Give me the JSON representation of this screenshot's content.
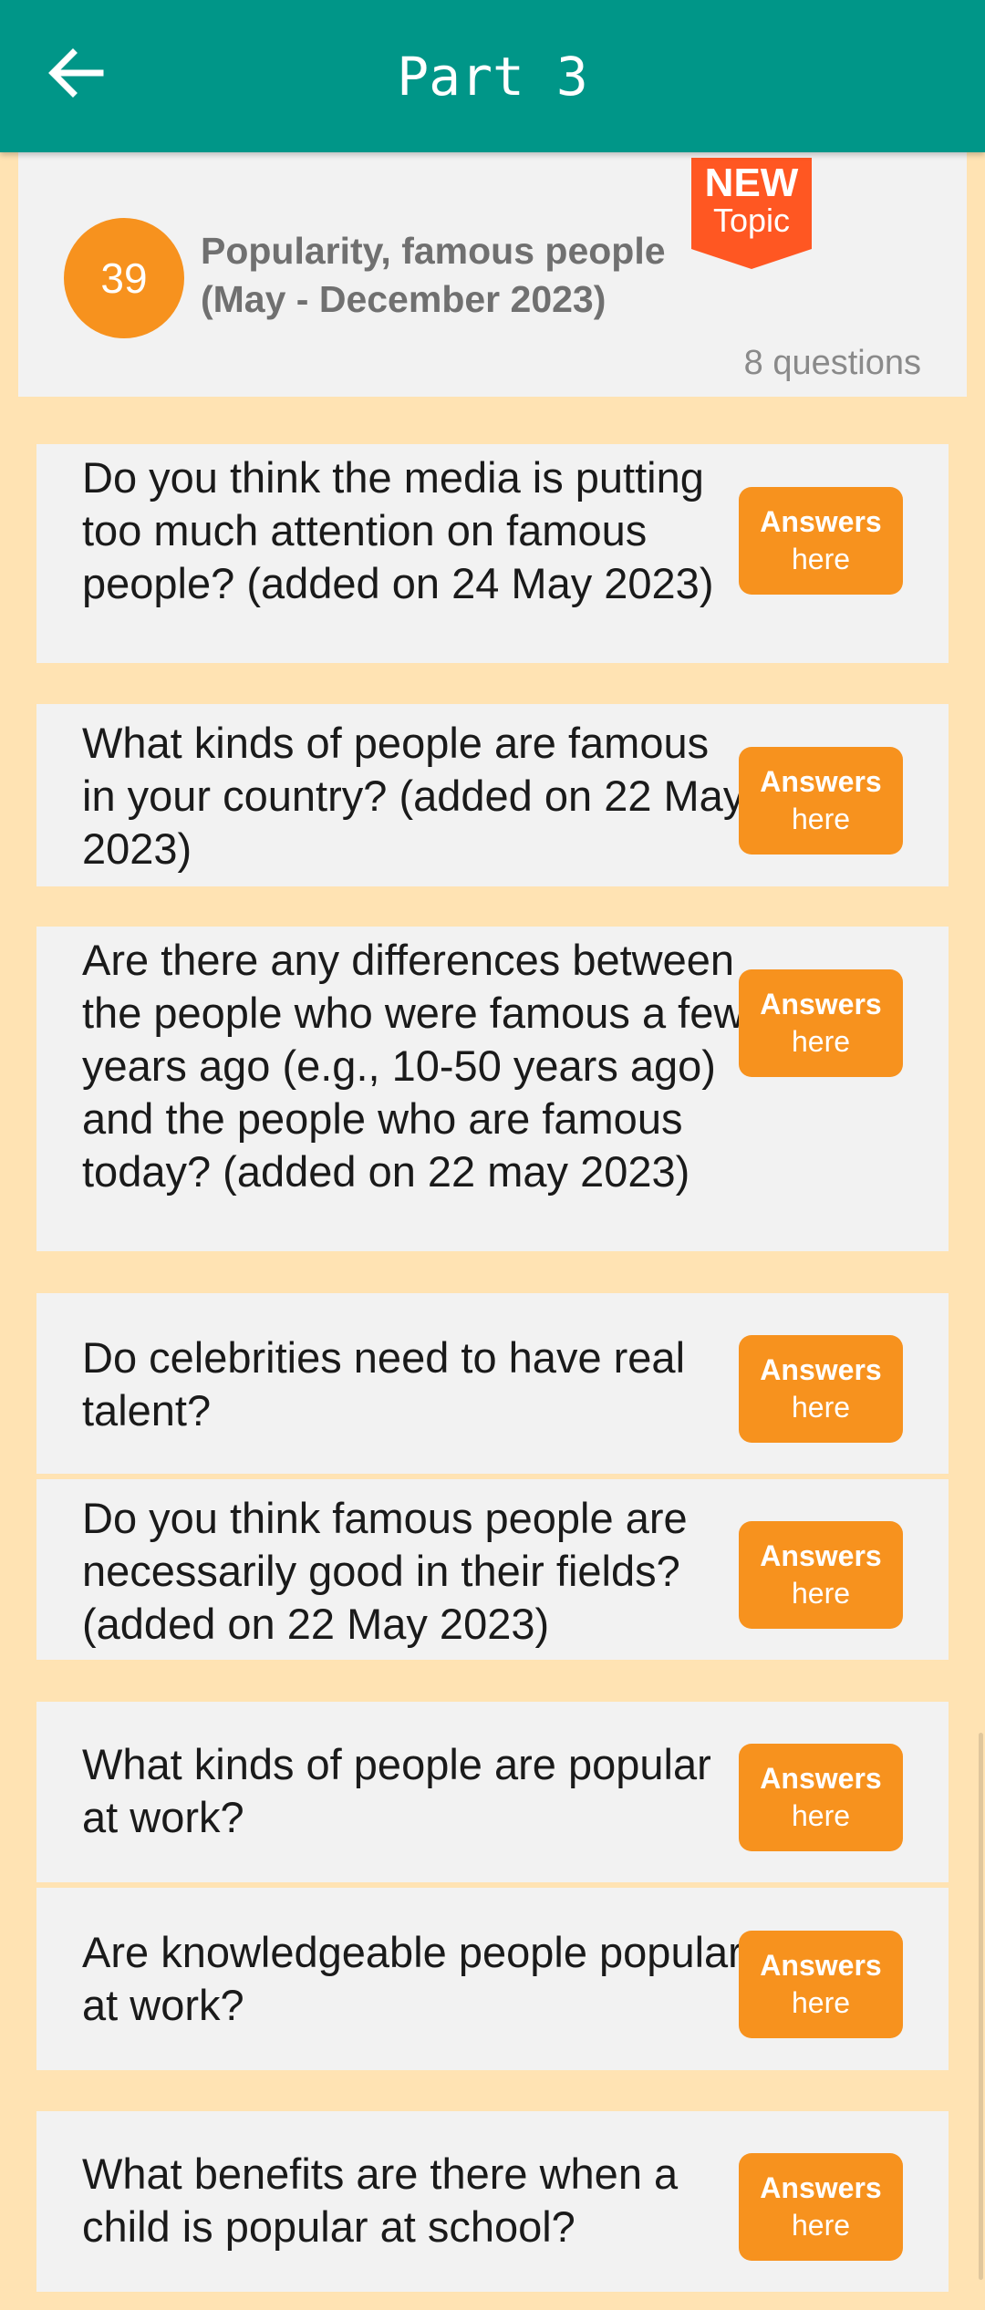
{
  "appbar": {
    "title": "Part 3",
    "back_icon": "arrow-left-icon"
  },
  "topic": {
    "number": "39",
    "title": "Popularity, famous people (May - December 2023)",
    "count": "8 questions",
    "badge_line1": "NEW",
    "badge_line2": "Topic"
  },
  "answer_button": {
    "line1": "Answers",
    "line2": "here"
  },
  "questions": [
    {
      "text": "Do you think the media is putting too much attention on famous people? (added on 24 May 2023)"
    },
    {
      "text": "What kinds of people are famous in your country? (added on 22 May 2023)"
    },
    {
      "text": "Are there any differences between the people who were famous a few years ago (e.g., 10-50 years ago) and the people who are famous today? (added on 22 may 2023)"
    },
    {
      "text": "Do celebrities need to have real talent?"
    },
    {
      "text": "Do you think famous people are necessarily good in their fields? (added on 22 May 2023)"
    },
    {
      "text": "What kinds of people are popular at work?"
    },
    {
      "text": "Are knowledgeable people popular at work?"
    },
    {
      "text": "What benefits are there when a child is popular at school?"
    }
  ],
  "colors": {
    "appbar": "#009688",
    "background": "#FFE3B3",
    "card": "#F2F2F2",
    "accent": "#F7921E",
    "badge": "#FF5722"
  }
}
